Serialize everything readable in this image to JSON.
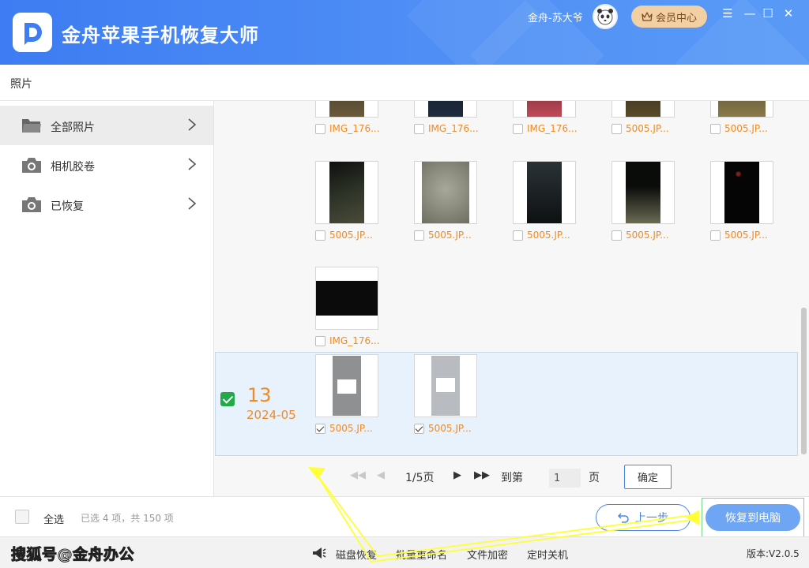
{
  "app": {
    "title": "金舟苹果手机恢复大师",
    "user_name": "金舟-苏大爷",
    "vip_label": "会员中心",
    "icons": {
      "logo": "app-logo-icon",
      "vip": "crown-icon",
      "menu": "menu-icon",
      "minimize": "minimize-icon",
      "maximize": "maximize-icon",
      "close": "close-icon"
    }
  },
  "breadcrumb": "照片",
  "sidebar": {
    "items": [
      {
        "label": "全部照片",
        "icon": "folder-icon",
        "active": true
      },
      {
        "label": "相机胶卷",
        "icon": "camera-icon",
        "active": false
      },
      {
        "label": "已恢复",
        "icon": "camera-icon",
        "active": false
      }
    ]
  },
  "photos": {
    "row1": [
      "IMG_176...",
      "IMG_176...",
      "IMG_176...",
      "5005.JP...",
      "5005.JP..."
    ],
    "row2": [
      "5005.JP...",
      "5005.JP...",
      "5005.JP...",
      "5005.JP...",
      "5005.JP..."
    ],
    "row3": [
      "IMG_176..."
    ]
  },
  "group": {
    "day": "13",
    "month": "2024-05",
    "checked": true,
    "photos": [
      {
        "name": "5005.JP...",
        "checked": true
      },
      {
        "name": "5005.JP...",
        "checked": true
      }
    ]
  },
  "pager": {
    "page_text": "1/5页",
    "goto_label": "到第",
    "page_value": "1",
    "page_suffix": "页",
    "confirm_label": "确定"
  },
  "footer": {
    "select_all_label": "全选",
    "selection_info": "已选 4 项，共 150 项",
    "back_label": "上一步",
    "recover_label": "恢复到电脑"
  },
  "bottom": {
    "watermark": "搜狐号@金舟办公",
    "tools": [
      "磁盘恢复",
      "批量重命名",
      "文件加密",
      "定时关机"
    ],
    "version": "版本:V2.0.5"
  },
  "colors": {
    "header": "#4a88f4",
    "accent": "#f08a24",
    "primary_button": "#6fa6f4",
    "selected_bg": "#e8f2fd",
    "check_green": "#23a84a",
    "annotation": "#ffff33"
  }
}
